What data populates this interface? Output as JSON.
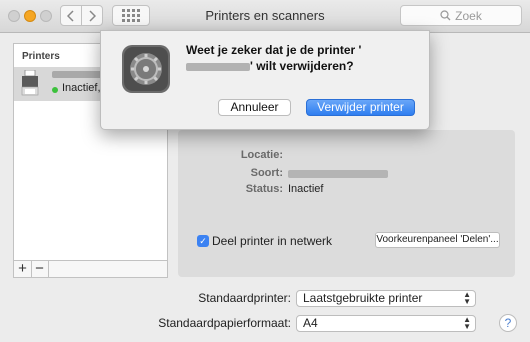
{
  "window": {
    "title": "Printers en scanners"
  },
  "search": {
    "placeholder": "Zoek"
  },
  "printers": {
    "header": "Printers",
    "items": [
      {
        "status": "Inactief, L"
      }
    ]
  },
  "details": {
    "location_label": "Locatie:",
    "type_label": "Soort:",
    "status_label": "Status:",
    "status_value": "Inactief",
    "share_label": "Deel printer in netwerk",
    "share_checked": true,
    "sharing_prefs_button": "Voorkeurenpaneel 'Delen'..."
  },
  "defaults": {
    "default_printer_label": "Standaardprinter:",
    "default_printer_value": "Laatstgebruikte printer",
    "paper_size_label": "Standaardpapierformaat:",
    "paper_size_value": "A4"
  },
  "dialog": {
    "message_part1": "Weet je zeker dat je de printer '",
    "message_part2": "' wilt verwijderen?",
    "cancel_label": "Annuleer",
    "confirm_label": "Verwijder printer"
  },
  "help": {
    "label": "?"
  },
  "colors": {
    "accent": "#2f7ef0",
    "status_green": "#3cc13c"
  }
}
